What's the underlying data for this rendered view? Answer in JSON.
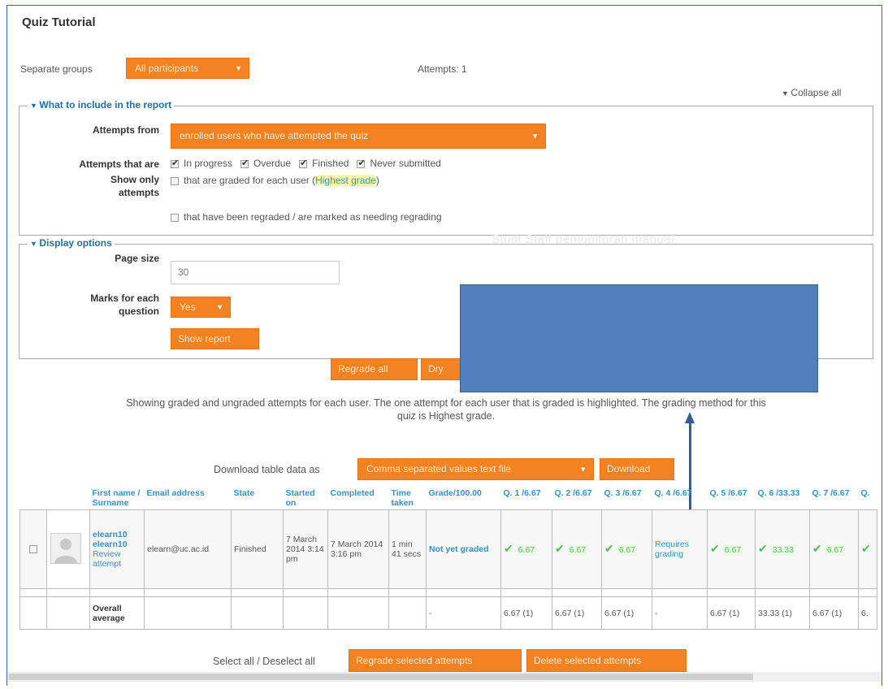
{
  "page": {
    "title": "Quiz Tutorial"
  },
  "groups": {
    "label": "Separate groups",
    "selected": "All participants",
    "attempts": "Attempts: 1"
  },
  "collapse_all": "Collapse all",
  "include": {
    "legend": "What to include in the report",
    "attempts_from_label": "Attempts from",
    "attempts_from_value": "enrolled users who have attempted the quiz",
    "attempts_that_are_label": "Attempts that are",
    "states": [
      {
        "label": "In progress",
        "checked": true
      },
      {
        "label": "Overdue",
        "checked": true
      },
      {
        "label": "Finished",
        "checked": true
      },
      {
        "label": "Never submitted",
        "checked": true
      }
    ],
    "show_only_label": "Show only attempts",
    "graded_prefix": "that are graded for each user (",
    "graded_link": "Highest grade",
    "graded_suffix": ")",
    "regraded_label": "that have been regraded / are marked as needing regrading"
  },
  "display": {
    "legend": "Display options",
    "page_size_label": "Page size",
    "page_size_value": "30",
    "marks_label": "Marks for each question",
    "marks_value": "Yes",
    "show_report": "Show report"
  },
  "actions": {
    "regrade_all": "Regrade all",
    "dry_run": "Dry"
  },
  "info_line1": "Showing graded and ungraded attempts for each user. The one attempt for each user that is graded is highlighted. The grading method for this",
  "info_line2": "quiz is Highest grade.",
  "download": {
    "label": "Download table data as",
    "format": "Comma separated values text file",
    "button": "Download"
  },
  "watermark": "Studi Staff pemonitoran manual",
  "table": {
    "headers": [
      "First name / Surname",
      "Email address",
      "State",
      "Started on",
      "Completed",
      "Time taken",
      "Grade/100.00",
      "Q. 1 /6.67",
      "Q. 2 /6.67",
      "Q. 3 /6.67",
      "Q. 4 /6.67",
      "Q. 5 /6.67",
      "Q. 6 /33.33",
      "Q. 7 /6.67",
      "Q."
    ],
    "row": {
      "name1": "elearn10",
      "name2": "elearn10",
      "review": "Review attempt",
      "email": "elearn@uc.ac.id",
      "state": "Finished",
      "started": "7 March 2014 3:14 pm",
      "completed": "7 March 2014 3:16 pm",
      "time": "1 min 41 secs",
      "grade": "Not yet graded",
      "q": [
        "6.67",
        "6.67",
        "6.67",
        "Requires grading",
        "6.67",
        "33.33",
        "6.67"
      ]
    },
    "avg": {
      "label": "Overall average",
      "grade": "-",
      "q": [
        "6.67 (1)",
        "6.67 (1)",
        "6.67 (1)",
        "-",
        "6.67 (1)",
        "33.33 (1)",
        "6.67 (1)",
        "6."
      ]
    }
  },
  "bottom": {
    "select_all": "Select all / Deselect all",
    "regrade_selected": "Regrade selected attempts",
    "delete_selected": "Delete selected attempts"
  }
}
